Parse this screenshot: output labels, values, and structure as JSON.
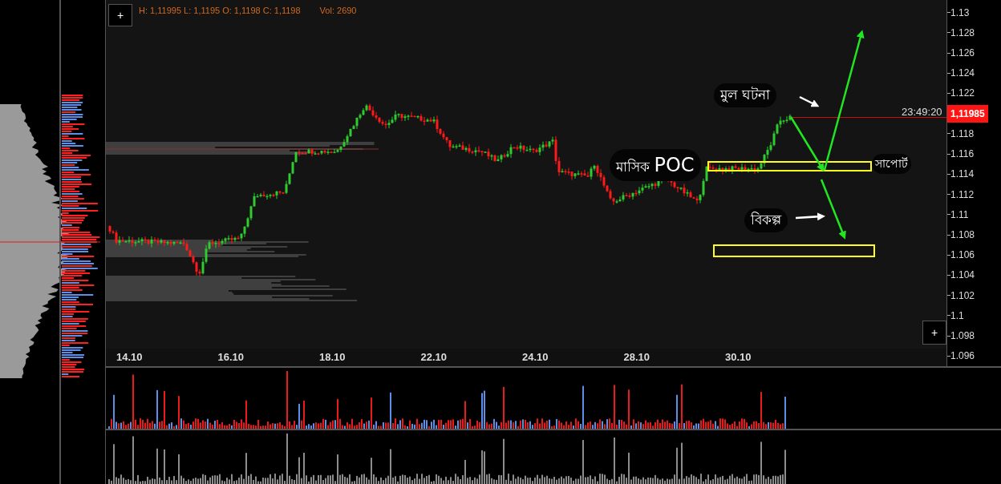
{
  "toolbar": {
    "add_button": "+",
    "ohlc": "H: 1,11995 L: 1,1195 O: 1,1198 C: 1,1198",
    "volume": "Vol: 2690"
  },
  "price_axis": [
    {
      "kind": "tick",
      "text": "1.13"
    },
    {
      "kind": "tick",
      "text": "1.128"
    },
    {
      "kind": "tick",
      "text": "1.126"
    },
    {
      "kind": "tick",
      "text": "1.124"
    },
    {
      "kind": "tick",
      "text": "1.122"
    },
    {
      "kind": "current",
      "text": "1,11985"
    },
    {
      "kind": "tick",
      "text": "1.118"
    },
    {
      "kind": "tick",
      "text": "1.116"
    },
    {
      "kind": "tick",
      "text": "1.114"
    },
    {
      "kind": "tick",
      "text": "1.112"
    },
    {
      "kind": "tick",
      "text": "1.11"
    },
    {
      "kind": "tick",
      "text": "1.108"
    },
    {
      "kind": "tick",
      "text": "1.106"
    },
    {
      "kind": "tick",
      "text": "1.104"
    },
    {
      "kind": "tick",
      "text": "1.102"
    },
    {
      "kind": "tick",
      "text": "1.1"
    },
    {
      "kind": "tick",
      "text": "1.098"
    },
    {
      "kind": "tick",
      "text": "1.096"
    }
  ],
  "countdown": "23:49:20",
  "date_axis": [
    "14.10",
    "16.10",
    "18.10",
    "22.10",
    "24.10",
    "28.10",
    "30.10"
  ],
  "annotations": [
    {
      "kind": "event",
      "text": "মুল ঘটনা"
    },
    {
      "kind": "poc",
      "text": "মাসিক",
      "emphasis": "POC"
    },
    {
      "kind": "support",
      "text": "সাপোর্ট"
    },
    {
      "kind": "alternative",
      "text": "বিকল্প"
    }
  ],
  "corner_button": "+"
}
